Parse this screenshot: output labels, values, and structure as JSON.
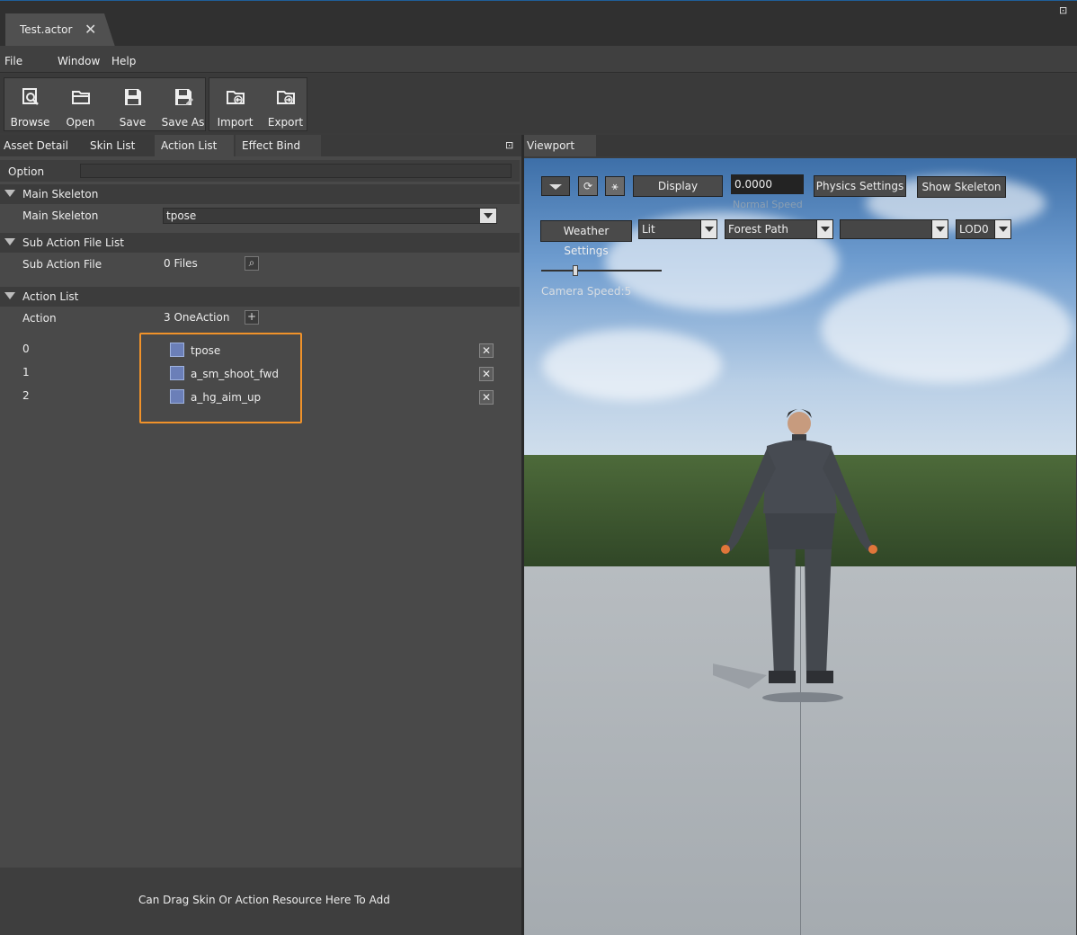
{
  "document_tab": {
    "title": "Test.actor",
    "close": "✕"
  },
  "menu": [
    "File",
    "Window",
    "Help"
  ],
  "toolbar": {
    "group1": [
      {
        "label": "Browse",
        "icon": "browse-icon"
      },
      {
        "label": "Open",
        "icon": "folder-open-icon"
      },
      {
        "label": "Save",
        "icon": "floppy-icon"
      },
      {
        "label": "Save As",
        "icon": "floppy-edit-icon"
      }
    ],
    "group2": [
      {
        "label": "Import",
        "icon": "import-icon"
      },
      {
        "label": "Export",
        "icon": "export-icon"
      }
    ]
  },
  "left_tabs": [
    "Asset Detail",
    "Skin List",
    "Action List",
    "Effect Bind"
  ],
  "option_label": "Option",
  "sections": {
    "main_skeleton": {
      "header": "Main Skeleton",
      "label": "Main Skeleton",
      "value": "tpose"
    },
    "sub_action": {
      "header": "Sub Action File List",
      "label": "Sub Action File",
      "value": "0 Files"
    },
    "action_list": {
      "header": "Action List",
      "label": "Action",
      "value": "3 OneAction"
    }
  },
  "actions": [
    {
      "index": "0",
      "name": "tpose"
    },
    {
      "index": "1",
      "name": "a_sm_shoot_fwd"
    },
    {
      "index": "2",
      "name": "a_hg_aim_up"
    }
  ],
  "drop_hint": "Can Drag Skin Or Action Resource Here To Add",
  "viewport": {
    "tab": "Viewport",
    "display_label": "Display",
    "time_value": "0.0000",
    "normal_speed": "Normal Speed",
    "physics_label": "Physics Settings",
    "skeleton_label": "Show Skeleton",
    "weather_label": "Weather Settings",
    "light_mode": "Lit",
    "scene": "Forest Path",
    "empty_select": "",
    "lod": "LOD0",
    "camera_speed": "Camera Speed:5",
    "camera_speed_value": 0.27
  },
  "colors": {
    "highlight": "#f0922a",
    "accent": "#1f5f99"
  }
}
